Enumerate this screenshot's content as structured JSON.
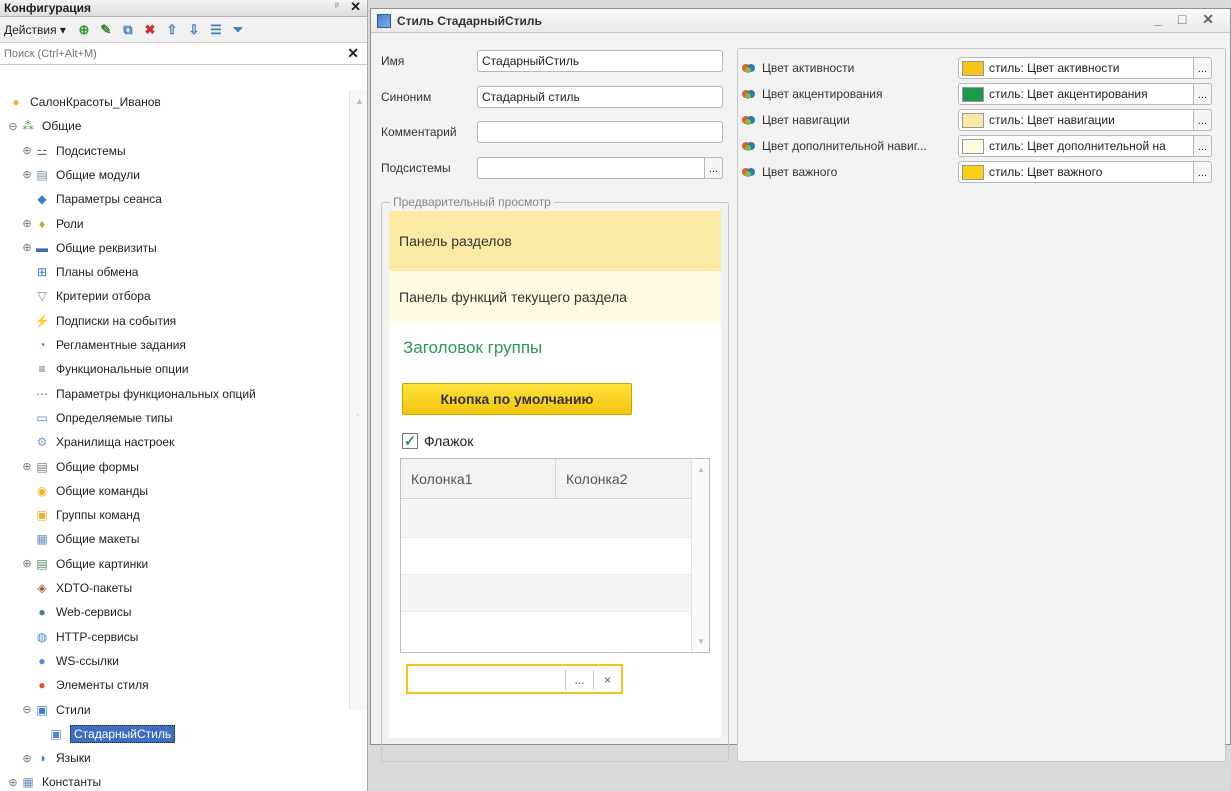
{
  "config_panel": {
    "title": "Конфигурация",
    "actions_label": "Действия ▾",
    "search_placeholder": "Поиск (Ctrl+Alt+M)",
    "tree": [
      {
        "label": "СалонКрасоты_Иванов",
        "icon": "config-root-icon",
        "level": 0,
        "expander": ""
      },
      {
        "label": "Общие",
        "icon": "common-icon",
        "level": 1,
        "expander": "⊖"
      },
      {
        "label": "Подсистемы",
        "icon": "subsystems-icon",
        "level": 2,
        "expander": "⊕"
      },
      {
        "label": "Общие модули",
        "icon": "modules-icon",
        "level": 2,
        "expander": "⊕"
      },
      {
        "label": "Параметры сеанса",
        "icon": "session-params-icon",
        "level": 2,
        "expander": ""
      },
      {
        "label": "Роли",
        "icon": "roles-icon",
        "level": 2,
        "expander": "⊕"
      },
      {
        "label": "Общие реквизиты",
        "icon": "attributes-icon",
        "level": 2,
        "expander": "⊕"
      },
      {
        "label": "Планы обмена",
        "icon": "exchange-plans-icon",
        "level": 2,
        "expander": ""
      },
      {
        "label": "Критерии отбора",
        "icon": "filter-criteria-icon",
        "level": 2,
        "expander": ""
      },
      {
        "label": "Подписки на события",
        "icon": "event-subscriptions-icon",
        "level": 2,
        "expander": ""
      },
      {
        "label": "Регламентные задания",
        "icon": "scheduled-jobs-icon",
        "level": 2,
        "expander": ""
      },
      {
        "label": "Функциональные опции",
        "icon": "functional-options-icon",
        "level": 2,
        "expander": ""
      },
      {
        "label": "Параметры функциональных опций",
        "icon": "fo-params-icon",
        "level": 2,
        "expander": ""
      },
      {
        "label": "Определяемые типы",
        "icon": "defined-types-icon",
        "level": 2,
        "expander": ""
      },
      {
        "label": "Хранилища настроек",
        "icon": "settings-storage-icon",
        "level": 2,
        "expander": ""
      },
      {
        "label": "Общие формы",
        "icon": "forms-icon",
        "level": 2,
        "expander": "⊕"
      },
      {
        "label": "Общие команды",
        "icon": "commands-icon",
        "level": 2,
        "expander": ""
      },
      {
        "label": "Группы команд",
        "icon": "command-groups-icon",
        "level": 2,
        "expander": ""
      },
      {
        "label": "Общие макеты",
        "icon": "templates-icon",
        "level": 2,
        "expander": ""
      },
      {
        "label": "Общие картинки",
        "icon": "pictures-icon",
        "level": 2,
        "expander": "⊕"
      },
      {
        "label": "XDTO-пакеты",
        "icon": "xdto-icon",
        "level": 2,
        "expander": ""
      },
      {
        "label": "Web-сервисы",
        "icon": "web-services-icon",
        "level": 2,
        "expander": ""
      },
      {
        "label": "HTTP-сервисы",
        "icon": "http-services-icon",
        "level": 2,
        "expander": ""
      },
      {
        "label": "WS-ссылки",
        "icon": "ws-links-icon",
        "level": 2,
        "expander": ""
      },
      {
        "label": "Элементы стиля",
        "icon": "style-items-icon",
        "level": 2,
        "expander": ""
      },
      {
        "label": "Стили",
        "icon": "styles-icon",
        "level": 2,
        "expander": "⊖"
      },
      {
        "label": "СтадарныйСтиль",
        "icon": "style-icon",
        "level": 3,
        "expander": "",
        "selected": true
      },
      {
        "label": "Языки",
        "icon": "languages-icon",
        "level": 2,
        "expander": "⊕"
      },
      {
        "label": "Константы",
        "icon": "constants-icon",
        "level": 0,
        "expander": "⊕"
      }
    ]
  },
  "style_window": {
    "title": "Стиль СтадарныйСтиль",
    "buttons": "_ □ ✕",
    "fields": {
      "name_label": "Имя",
      "name_value": "СтадарныйСтиль",
      "synonym_label": "Синоним",
      "synonym_value": "Стадарный стиль",
      "comment_label": "Комментарий",
      "comment_value": "",
      "subsystems_label": "Подсистемы",
      "subsystems_value": ""
    },
    "preview": {
      "legend": "Предварительный просмотр",
      "sections_panel": "Панель разделов",
      "functions_panel": "Панель функций текущего раздела",
      "group_title": "Заголовок группы",
      "default_button": "Кнопка по умолчанию",
      "checkbox_label": "Флажок",
      "checkbox_checked": true,
      "columns": [
        "Колонка1",
        "Колонка2"
      ],
      "input_value": ""
    },
    "colors": [
      {
        "name": "Цвет активности",
        "value": "стиль: Цвет активности",
        "swatch": "#f5c517"
      },
      {
        "name": "Цвет акцентирования",
        "value": "стиль: Цвет акцентирования",
        "swatch": "#1a9a4a"
      },
      {
        "name": "Цвет навигации",
        "value": "стиль: Цвет навигации",
        "swatch": "#fbe6a8"
      },
      {
        "name": "Цвет дополнительной навиг...",
        "value": "стиль: Цвет дополнительной на",
        "swatch": "#fffbe0"
      },
      {
        "name": "Цвет важного",
        "value": "стиль: Цвет важного",
        "swatch": "#f8d016"
      }
    ],
    "colors_theme": {
      "sections_bg": "#fbe9a4",
      "functions_bg": "#fffbe0",
      "accent": "#2b9a52",
      "button_yellow": "#f5cc1b"
    }
  }
}
